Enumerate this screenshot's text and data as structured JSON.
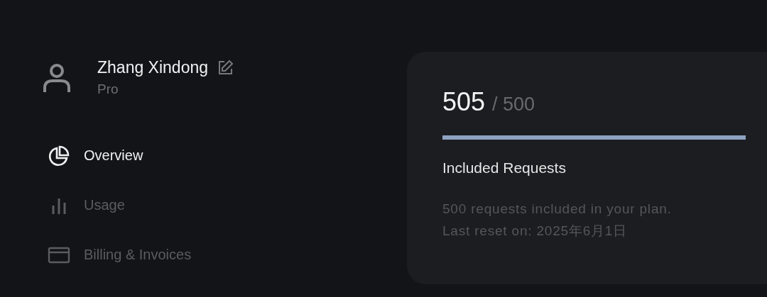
{
  "user": {
    "name": "Zhang Xindong",
    "plan": "Pro"
  },
  "nav": [
    {
      "label": "Overview",
      "selected": true
    },
    {
      "label": "Usage",
      "selected": false
    },
    {
      "label": "Billing & Invoices",
      "selected": false
    }
  ],
  "usage_card": {
    "used": "505",
    "total": "/ 500",
    "level": 1,
    "title": "Included Requests",
    "description": [
      "500 requests included in your plan.",
      "Last reset on: 2025年6月1日"
    ]
  }
}
